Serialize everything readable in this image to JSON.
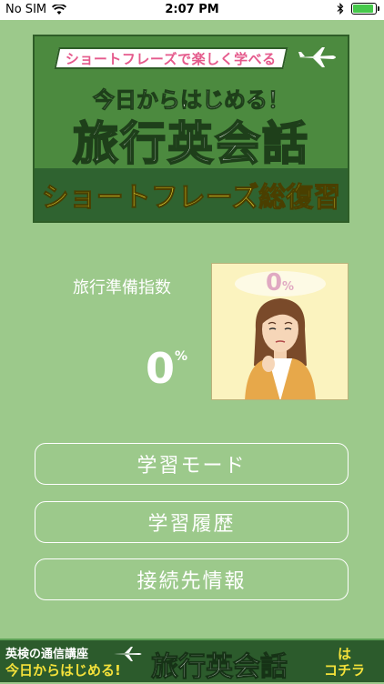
{
  "status_bar": {
    "carrier": "No SIM",
    "time": "2:07 PM",
    "battery_level": 0.85
  },
  "banner": {
    "tagline": "ショートフレーズで楽しく学べる",
    "title_top": "今日からはじめる！",
    "title_main": "旅行英会話",
    "subtitle": "ショートフレーズ総復習"
  },
  "readiness": {
    "label": "旅行準備指数",
    "value": "0",
    "unit": "%",
    "portrait_value": "0",
    "portrait_unit": "%"
  },
  "menu": {
    "study_mode": "学習モード",
    "history": "学習履歴",
    "connection_info": "接続先情報"
  },
  "ad_banner": {
    "small_text": "英検の通信講座",
    "mid_text": "今日からはじめる!",
    "big_text": "旅行英会話",
    "ha": "は",
    "link_text": "コチラ"
  },
  "colors": {
    "background": "#9cc98b",
    "banner_green": "#4c8a3f",
    "banner_dark": "#2f6330",
    "accent_yellow": "#f6e63a",
    "accent_pink": "#b22a67"
  }
}
